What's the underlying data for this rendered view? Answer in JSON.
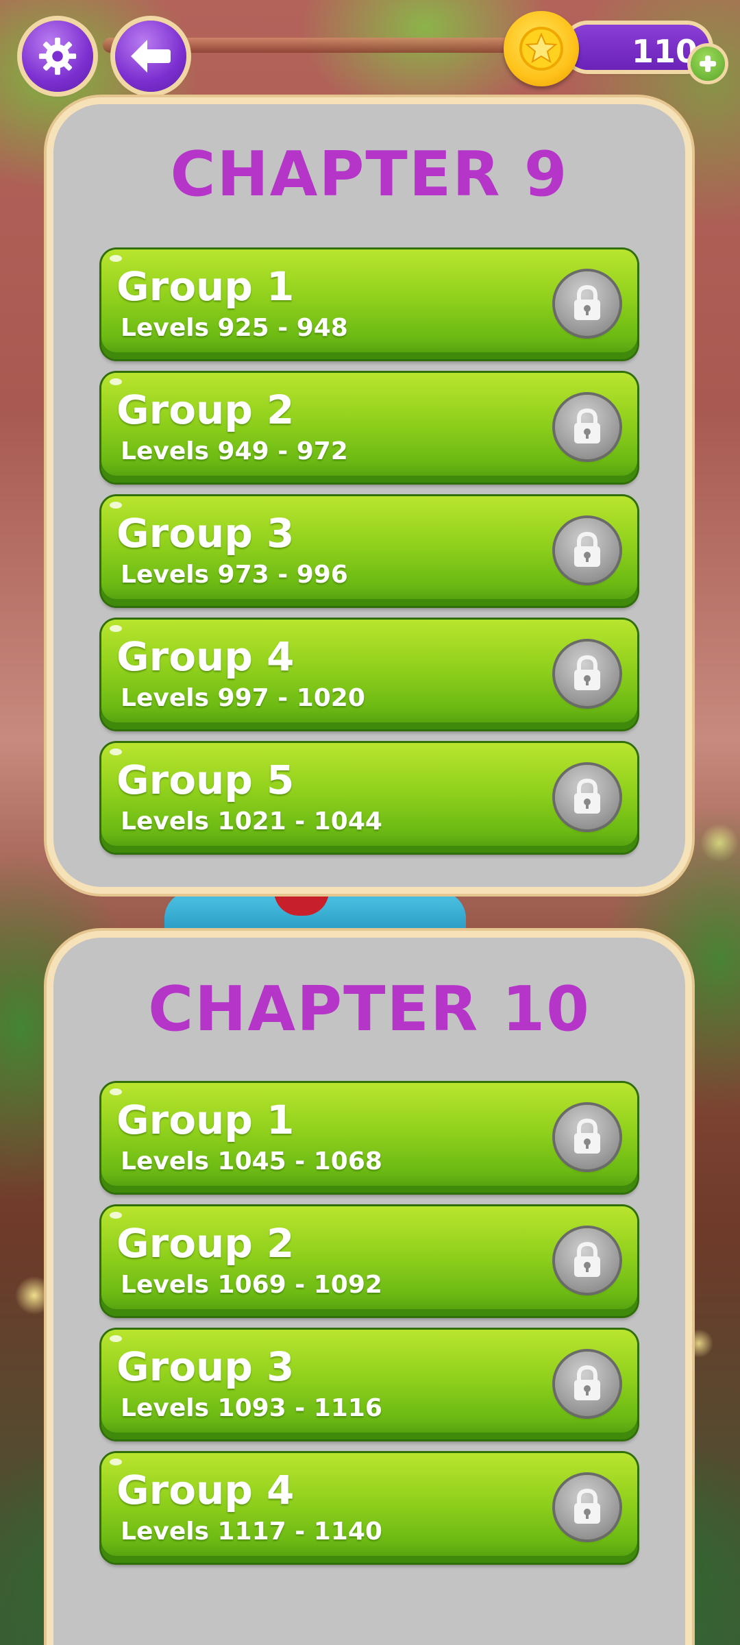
{
  "top_bar": {
    "settings_icon": "gear-icon",
    "back_icon": "arrow-left-icon",
    "coin_icon": "star-coin-icon",
    "coin_count": "110",
    "add_icon": "plus-icon"
  },
  "colors": {
    "chapter_title": "#b535c9",
    "button_green": "#8fd01c",
    "purple": "#7c2fd0",
    "card_bg": "#c3c3c3",
    "card_border": "#f6e2b9"
  },
  "chapters": [
    {
      "title": "CHAPTER 9",
      "groups": [
        {
          "name": "Group 1",
          "levels": "Levels 925 - 948",
          "locked": true
        },
        {
          "name": "Group 2",
          "levels": "Levels 949 - 972",
          "locked": true
        },
        {
          "name": "Group 3",
          "levels": "Levels 973 - 996",
          "locked": true
        },
        {
          "name": "Group 4",
          "levels": "Levels 997 - 1020",
          "locked": true
        },
        {
          "name": "Group 5",
          "levels": "Levels 1021 - 1044",
          "locked": true
        }
      ]
    },
    {
      "title": "CHAPTER 10",
      "groups": [
        {
          "name": "Group 1",
          "levels": "Levels 1045 - 1068",
          "locked": true
        },
        {
          "name": "Group 2",
          "levels": "Levels 1069 - 1092",
          "locked": true
        },
        {
          "name": "Group 3",
          "levels": "Levels 1093 - 1116",
          "locked": true
        },
        {
          "name": "Group 4",
          "levels": "Levels 1117 - 1140",
          "locked": true
        }
      ]
    }
  ]
}
